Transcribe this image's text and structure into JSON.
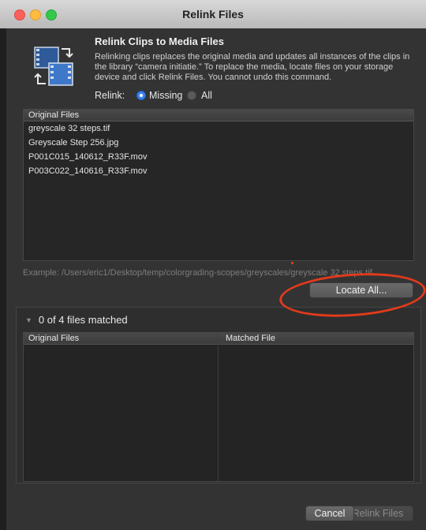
{
  "window": {
    "title": "Relink Files"
  },
  "header": {
    "title": "Relink Clips to Media Files",
    "description": "Relinking clips replaces the original media and updates all instances of the clips in the library “camera initiatie.” To replace the media, locate files on your storage device and click Relink Files. You cannot undo this command."
  },
  "relink": {
    "label": "Relink:",
    "options": [
      "Missing",
      "All"
    ],
    "selected": "Missing"
  },
  "original_files": {
    "column_header": "Original Files",
    "rows": [
      "greyscale 32 steps.tif",
      "Greyscale Step 256.jpg",
      "P001C015_140612_R33F.mov",
      "P003C022_140616_R33F.mov"
    ]
  },
  "example_path": "Example: /Users/eric1/Desktop/temp/colorgrading-scopes/greyscales/greyscale 32 steps.tif",
  "buttons": {
    "locate_all": "Locate All...",
    "cancel": "Cancel",
    "relink_files": "Relink Files"
  },
  "matched": {
    "summary": "0 of 4 files matched",
    "col_original": "Original Files",
    "col_matched": "Matched File"
  },
  "colors": {
    "annotation": "#e23a1c",
    "accent": "#3b82ee"
  },
  "icons": {
    "header": "relink-clips-icon",
    "disclosure": "disclosure-triangle-icon"
  }
}
